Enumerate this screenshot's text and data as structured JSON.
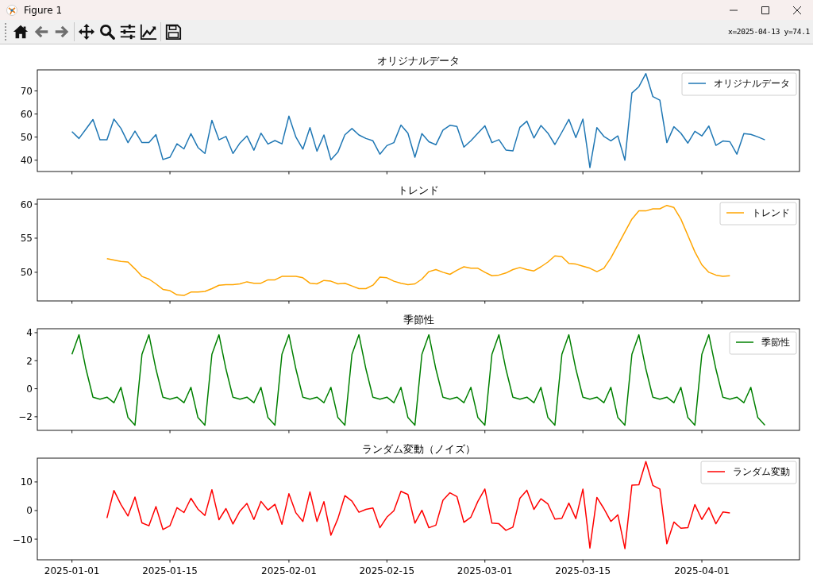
{
  "window": {
    "title": "Figure 1"
  },
  "toolbar": {
    "groups": [
      [
        {
          "kind": "home",
          "disabled": false
        },
        {
          "kind": "back",
          "disabled": true
        },
        {
          "kind": "forward",
          "disabled": true
        }
      ],
      [
        {
          "kind": "pan",
          "disabled": false
        },
        {
          "kind": "zoom",
          "disabled": false
        },
        {
          "kind": "subplots",
          "disabled": false
        },
        {
          "kind": "axes",
          "disabled": false
        }
      ],
      [
        {
          "kind": "save",
          "disabled": false
        }
      ]
    ],
    "coordinates": "x=2025-04-13 y=74.1"
  },
  "figure": {
    "subplots": [
      {
        "chart_data": {
          "type": "line",
          "title": "オリジナルデータ",
          "series": [
            {
              "name": "オリジナルデータ",
              "color": "#1f77b4",
              "values": [
                52.4,
                49.4,
                53.5,
                57.6,
                48.8,
                48.8,
                57.8,
                53.8,
                47.6,
                52.6,
                47.6,
                47.6,
                51.1,
                40.3,
                41.3,
                47.1,
                44.9,
                51.5,
                45.5,
                42.9,
                57.3,
                48.8,
                50.3,
                42.9,
                47.4,
                50.5,
                44.3,
                51.7,
                47.0,
                48.5,
                47.1,
                59.1,
                50.0,
                44.8,
                54.1,
                43.9,
                50.9,
                40.2,
                43.5,
                51.0,
                53.7,
                50.9,
                49.4,
                48.4,
                42.6,
                46.3,
                47.6,
                55.2,
                51.7,
                41.3,
                51.5,
                48.0,
                46.7,
                53.0,
                55.1,
                54.6,
                45.7,
                48.4,
                51.7,
                54.9,
                47.6,
                48.9,
                44.4,
                44.0,
                54.2,
                56.9,
                49.6,
                55.0,
                51.7,
                46.8,
                52.1,
                57.7,
                49.8,
                57.8,
                36.8,
                54.1,
                50.3,
                48.4,
                50.5,
                40.0,
                69.1,
                71.8,
                77.5,
                67.5,
                66.0,
                47.6,
                54.5,
                51.7,
                47.4,
                52.5,
                50.5,
                54.8,
                46.4,
                48.3,
                48.0,
                42.6,
                51.5,
                51.2,
                50.1,
                48.8
              ]
            }
          ],
          "ylim": [
            35.1,
            79.1
          ],
          "yticks": [
            {
              "value": 40,
              "label": "40"
            },
            {
              "value": 50,
              "label": "50"
            },
            {
              "value": 60,
              "label": "60"
            },
            {
              "value": 70,
              "label": "70"
            }
          ]
        }
      },
      {
        "chart_data": {
          "type": "line",
          "title": "トレンド",
          "series": [
            {
              "name": "トレンド",
              "color": "#ffa500",
              "values": [
                null,
                null,
                null,
                null,
                null,
                52.0,
                51.8,
                51.6,
                51.5,
                50.5,
                49.4,
                49.0,
                48.3,
                47.5,
                47.3,
                46.7,
                46.6,
                47.1,
                47.1,
                47.2,
                47.6,
                48.1,
                48.2,
                48.2,
                48.3,
                48.6,
                48.4,
                48.4,
                48.9,
                48.9,
                49.4,
                49.4,
                49.4,
                49.2,
                48.4,
                48.3,
                48.8,
                48.7,
                48.3,
                48.4,
                48.0,
                47.6,
                47.6,
                48.1,
                49.3,
                49.2,
                48.7,
                48.4,
                48.2,
                48.3,
                49.0,
                50.1,
                50.4,
                50.0,
                49.7,
                50.3,
                50.8,
                50.6,
                50.6,
                50.0,
                49.5,
                49.6,
                49.9,
                50.4,
                50.7,
                50.4,
                50.2,
                50.8,
                51.5,
                52.4,
                52.3,
                51.3,
                51.2,
                50.9,
                50.6,
                50.1,
                50.6,
                52.1,
                54.0,
                55.9,
                57.8,
                59.0,
                59.0,
                59.3,
                59.3,
                59.8,
                59.5,
                57.8,
                55.4,
                53.0,
                51.1,
                50.0,
                49.6,
                49.4,
                49.5,
                null,
                null,
                null,
                null,
                null
              ]
            }
          ],
          "ylim": [
            45.8,
            60.7
          ],
          "yticks": [
            {
              "value": 50,
              "label": "50"
            },
            {
              "value": 55,
              "label": "55"
            },
            {
              "value": 60,
              "label": "60"
            }
          ]
        }
      },
      {
        "chart_data": {
          "type": "line",
          "title": "季節性",
          "series": [
            {
              "name": "季節性",
              "color": "#008000",
              "values": [
                2.45,
                3.85,
                1.4,
                -0.6,
                -0.75,
                -0.6,
                -1.0,
                0.1,
                -2.05,
                -2.6,
                2.45,
                3.85,
                1.4,
                -0.6,
                -0.75,
                -0.6,
                -1.0,
                0.1,
                -2.05,
                -2.6,
                2.45,
                3.85,
                1.4,
                -0.6,
                -0.75,
                -0.6,
                -1.0,
                0.1,
                -2.05,
                -2.6,
                2.45,
                3.85,
                1.4,
                -0.6,
                -0.75,
                -0.6,
                -1.0,
                0.1,
                -2.05,
                -2.6,
                2.45,
                3.85,
                1.4,
                -0.6,
                -0.75,
                -0.6,
                -1.0,
                0.1,
                -2.05,
                -2.6,
                2.45,
                3.85,
                1.4,
                -0.6,
                -0.75,
                -0.6,
                -1.0,
                0.1,
                -2.05,
                -2.6,
                2.45,
                3.85,
                1.4,
                -0.6,
                -0.75,
                -0.6,
                -1.0,
                0.1,
                -2.05,
                -2.6,
                2.45,
                3.85,
                1.4,
                -0.6,
                -0.75,
                -0.6,
                -1.0,
                0.1,
                -2.05,
                -2.6,
                2.45,
                3.85,
                1.4,
                -0.6,
                -0.75,
                -0.6,
                -1.0,
                0.1,
                -2.05,
                -2.6,
                2.45,
                3.85,
                1.4,
                -0.6,
                -0.75,
                -0.6,
                -1.0,
                0.1,
                -2.05,
                -2.6
              ]
            }
          ],
          "ylim": [
            -2.97,
            4.28
          ],
          "yticks": [
            {
              "value": -2,
              "label": "−2"
            },
            {
              "value": 0,
              "label": "0"
            },
            {
              "value": 2,
              "label": "2"
            },
            {
              "value": 4,
              "label": "4"
            }
          ]
        }
      },
      {
        "chart_data": {
          "type": "line",
          "title": "ランダム変動（ノイズ）",
          "categories": [
            "2025-01-01",
            null,
            null,
            null,
            null,
            null,
            null,
            null,
            null,
            null,
            null,
            null,
            null,
            null,
            "2025-01-15",
            null,
            null,
            null,
            null,
            null,
            null,
            null,
            null,
            null,
            null,
            null,
            null,
            null,
            null,
            null,
            null,
            "2025-02-01",
            null,
            null,
            null,
            null,
            null,
            null,
            null,
            null,
            null,
            null,
            null,
            null,
            null,
            "2025-02-15",
            null,
            null,
            null,
            null,
            null,
            null,
            null,
            null,
            null,
            null,
            null,
            null,
            null,
            "2025-03-01",
            null,
            null,
            null,
            null,
            null,
            null,
            null,
            null,
            null,
            null,
            null,
            null,
            null,
            "2025-03-15",
            null,
            null,
            null,
            null,
            null,
            null,
            null,
            null,
            null,
            null,
            null,
            null,
            null,
            null,
            null,
            null,
            "2025-04-01",
            null,
            null,
            null,
            null,
            null,
            null,
            null,
            null,
            null
          ],
          "series": [
            {
              "name": "ランダム変動",
              "color": "#ff0000",
              "values": [
                null,
                null,
                null,
                null,
                null,
                -2.6,
                7.0,
                2.1,
                -1.9,
                4.7,
                -4.3,
                -5.3,
                1.4,
                -6.6,
                -5.3,
                1.0,
                -0.7,
                4.3,
                0.5,
                -1.7,
                7.3,
                -3.2,
                0.7,
                -4.7,
                -0.2,
                2.5,
                -3.1,
                3.2,
                0.2,
                2.2,
                -4.8,
                5.9,
                -0.8,
                -3.8,
                6.5,
                -3.8,
                3.1,
                -8.6,
                -2.8,
                5.2,
                3.3,
                -0.6,
                0.4,
                0.9,
                -6.0,
                -2.3,
                -0.1,
                6.7,
                5.6,
                -4.4,
                0.1,
                -6.0,
                -5.1,
                3.6,
                6.2,
                4.9,
                -4.1,
                -2.3,
                3.2,
                7.5,
                -4.4,
                -4.6,
                -6.9,
                -5.8,
                4.3,
                7.1,
                0.4,
                4.1,
                2.3,
                -3.0,
                -2.7,
                2.6,
                -2.8,
                7.5,
                -13.1,
                4.6,
                0.7,
                -3.8,
                -1.5,
                -13.3,
                8.9,
                9.0,
                17.1,
                8.8,
                7.5,
                -11.6,
                -4.0,
                -6.2,
                -6.0,
                2.1,
                -3.1,
                1.0,
                -4.6,
                -0.5,
                -0.8,
                null,
                null,
                null,
                null,
                null
              ]
            }
          ],
          "ylim": [
            -17.2,
            18.3
          ],
          "yticks": [
            {
              "value": -10,
              "label": "−10"
            },
            {
              "value": 0,
              "label": "0"
            },
            {
              "value": 10,
              "label": "10"
            }
          ]
        }
      }
    ]
  }
}
